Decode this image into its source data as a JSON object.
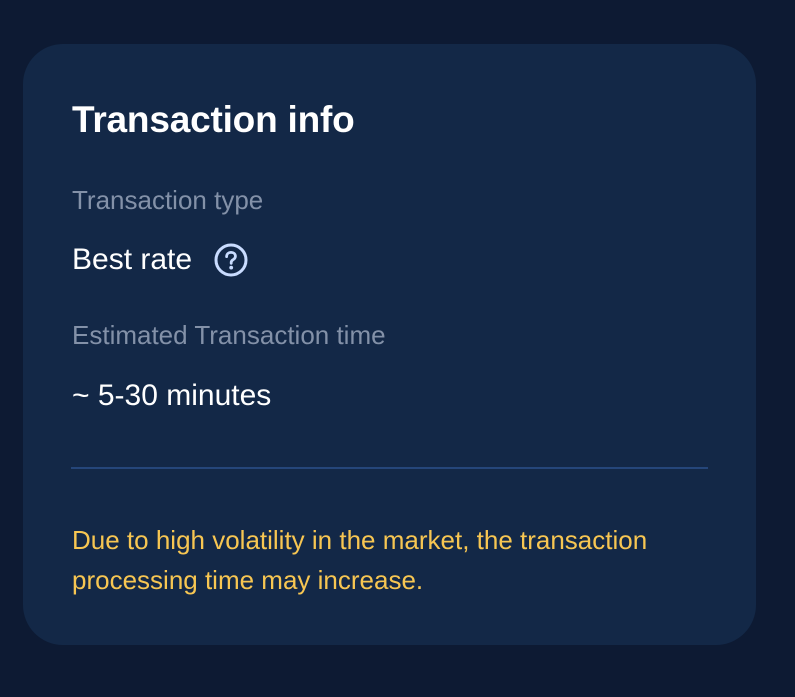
{
  "card": {
    "title": "Transaction info",
    "transaction_type": {
      "label": "Transaction type",
      "value": "Best rate",
      "help_icon": "question-circle-icon"
    },
    "transaction_time": {
      "label": "Estimated Transaction time",
      "value": "~ 5-30 minutes"
    },
    "notice": "Due to high volatility in the market, the transaction processing time may increase."
  },
  "colors": {
    "page_background": "#0d1a33",
    "card_background": "#132847",
    "title": "#ffffff",
    "label": "#8391a8",
    "value": "#ffffff",
    "divider": "#25467a",
    "notice": "#f7c652",
    "help_icon": "#c9dcff"
  }
}
